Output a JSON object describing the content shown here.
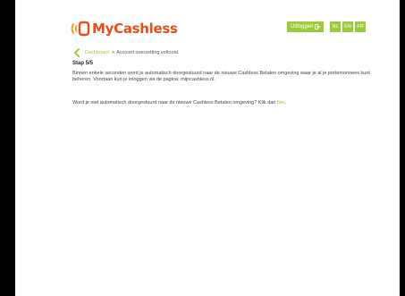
{
  "header": {
    "logo_text": "MyCashless",
    "logout_label": "Uitloggen",
    "languages": [
      "NL",
      "EN",
      "FR"
    ]
  },
  "breadcrumb": {
    "link": "Dashboard",
    "separator": ">",
    "current": "Account overzetting voltooid."
  },
  "content": {
    "step": "Stap 5/5",
    "paragraph1": "Binnen enkele seconden word je automatisch doorgestuurd naar de nieuwe Cashless Betalen omgeving waar je al je portemonnees kunt beheren. Voortaan kun je inloggen via de pagina: mijncashless.nl.",
    "paragraph2_prefix": "Word je niet automatisch doorgestuurd naar de nieuwe Cashless Betalen omgeving? Klik dan ",
    "paragraph2_link": "hier",
    "paragraph2_suffix": "."
  },
  "colors": {
    "brand": "#e84e1b",
    "accent": "#9ccc3c",
    "background_outer": "#000000"
  }
}
